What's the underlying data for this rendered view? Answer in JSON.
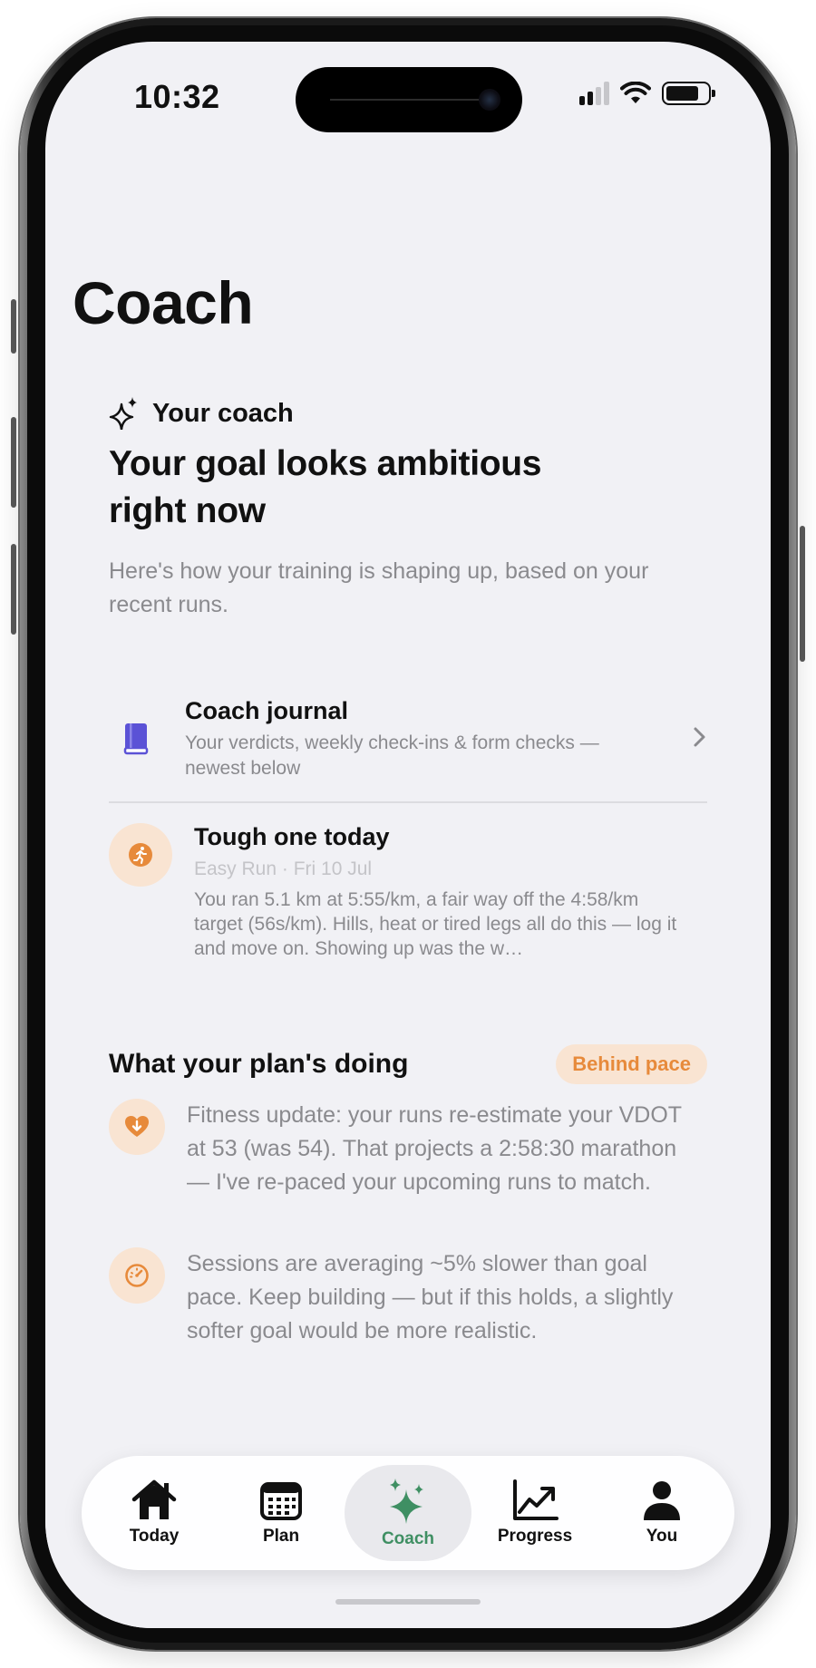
{
  "status_bar": {
    "time": "10:32"
  },
  "page": {
    "title": "Coach"
  },
  "coach_card": {
    "label": "Your coach",
    "headline": "Your goal looks ambitious right now",
    "intro": "Here's how your training is shaping up, based on your recent runs."
  },
  "journal": {
    "title": "Coach journal",
    "subtitle": "Your verdicts, weekly check-ins & form checks — newest below"
  },
  "latest_entry": {
    "title": "Tough one today",
    "meta": "Easy Run · Fri 10 Jul",
    "body": "You ran 5.1 km at 5:55/km, a fair way off the 4:58/km target (56s/km). Hills, heat or tired legs all do this — log it and move on. Showing up was the w…"
  },
  "plan": {
    "heading": "What your plan's doing",
    "badge": "Behind pace",
    "items": [
      {
        "icon": "heart-down-icon",
        "text": "Fitness update: your runs re-estimate your VDOT at 53 (was 54). That projects a 2:58:30 marathon — I've re-paced your upcoming runs to match."
      },
      {
        "icon": "gauge-icon",
        "text": "Sessions are averaging ~5% slower than goal pace. Keep building — but if this holds, a slightly softer goal would be more realistic."
      }
    ]
  },
  "tabbar": {
    "items": [
      {
        "label": "Today",
        "icon": "home-icon"
      },
      {
        "label": "Plan",
        "icon": "calendar-icon"
      },
      {
        "label": "Coach",
        "icon": "sparkles-icon",
        "active": true
      },
      {
        "label": "Progress",
        "icon": "chart-up-icon"
      },
      {
        "label": "You",
        "icon": "person-icon"
      }
    ]
  },
  "colors": {
    "accent_orange": "#e78a3b",
    "accent_green": "#3f8f63",
    "journal_purple": "#5b52d6",
    "background": "#f1f1f5"
  }
}
